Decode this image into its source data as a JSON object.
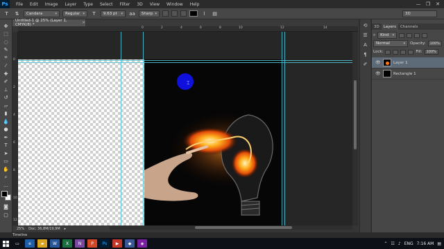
{
  "app": {
    "logo": "Ps"
  },
  "menu": [
    "File",
    "Edit",
    "Image",
    "Layer",
    "Type",
    "Select",
    "Filter",
    "3D",
    "View",
    "Window",
    "Help"
  ],
  "window_controls": [
    "—",
    "❐",
    "✕"
  ],
  "options": {
    "font_family": "Candara",
    "font_style": "Regular",
    "font_size": "9.63 pt",
    "antialias": "Sharp",
    "color": "#000000",
    "workspace": "3D"
  },
  "document": {
    "tab_title": "Untitled-1 @ 25% (Layer 1, CMYK/8) *",
    "close": "×",
    "ruler_h": [
      "0",
      "2",
      "4",
      "6",
      "8",
      "10",
      "12",
      "14"
    ],
    "ruler_v": [
      "0",
      "2",
      "4",
      "6",
      "8",
      "10",
      "12"
    ]
  },
  "status": {
    "zoom": "25%",
    "doc": "Doc: 36,8M/19,9M"
  },
  "timeline_label": "Timeline",
  "panel": {
    "tabs": [
      "3D",
      "Layers",
      "Channels"
    ],
    "kind_label": "Kind",
    "blend_mode": "Normal",
    "opacity_label": "Opacity:",
    "opacity_value": "100%",
    "lock_label": "Lock:",
    "fill_label": "Fill:",
    "fill_value": "100%",
    "layers": [
      {
        "name": "Layer 1"
      },
      {
        "name": "Rectangle 1"
      }
    ]
  },
  "taskbar": {
    "time": "7:16 AM",
    "lang": "ENG"
  },
  "colors": {
    "brush_cursor": "#1010dd",
    "guides": "#4fc3d6",
    "accent": "#31a8ff"
  }
}
